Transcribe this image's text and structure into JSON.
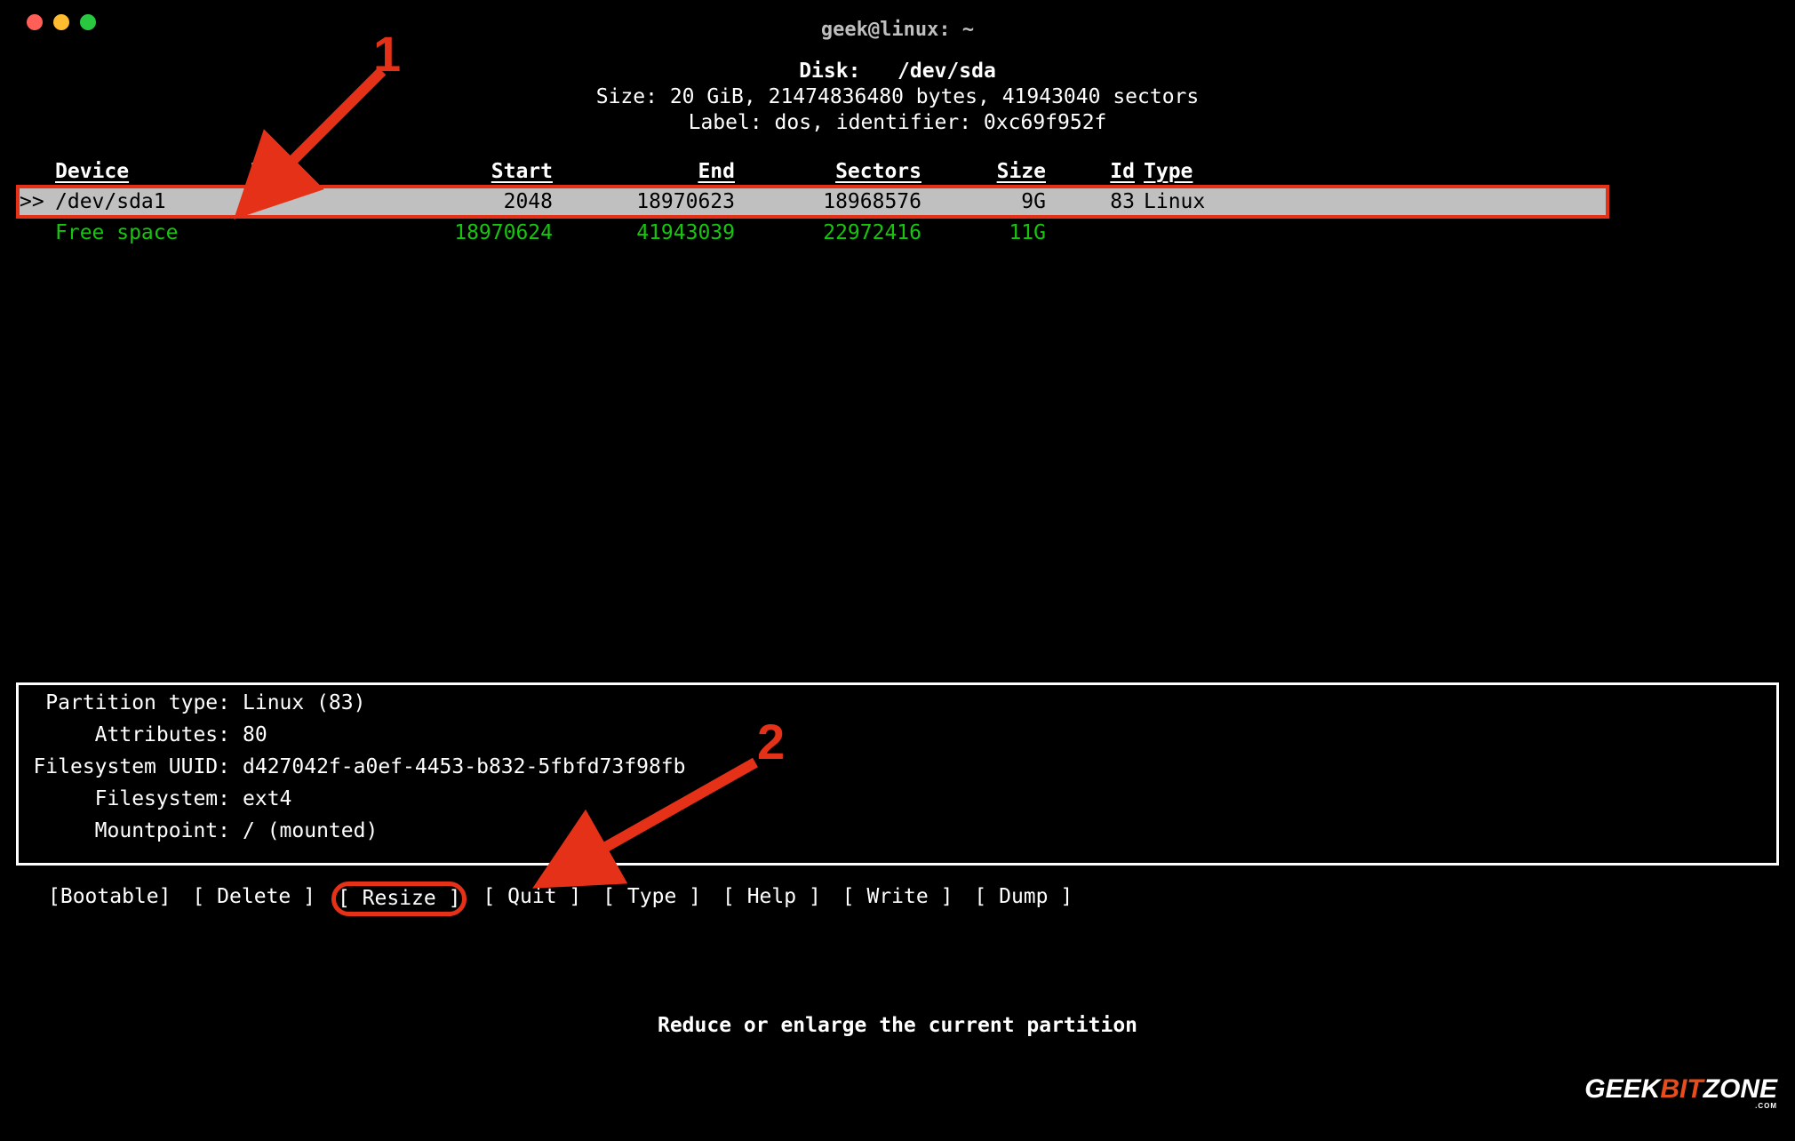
{
  "window": {
    "title": "geek@linux: ~"
  },
  "disk": {
    "label_text": "Disk:",
    "device": "/dev/sda",
    "size_line": "Size: 20 GiB, 21474836480 bytes, 41943040 sectors",
    "label_line": "Label: dos, identifier: 0xc69f952f"
  },
  "columns": {
    "device": "Device",
    "boot": "Boot",
    "start": "Start",
    "end": "End",
    "sectors": "Sectors",
    "size": "Size",
    "id": "Id",
    "type": "Type"
  },
  "rows": [
    {
      "cursor": ">>",
      "device": "/dev/sda1",
      "boot": "*",
      "start": "2048",
      "end": "18970623",
      "sectors": "18968576",
      "size": "9G",
      "id": "83",
      "type": "Linux",
      "selected": true,
      "free": false
    },
    {
      "cursor": "",
      "device": "Free space",
      "boot": "",
      "start": "18970624",
      "end": "41943039",
      "sectors": "22972416",
      "size": "11G",
      "id": "",
      "type": "",
      "selected": false,
      "free": true
    }
  ],
  "details": {
    "partition_type": {
      "key": "Partition type:",
      "value": "Linux (83)"
    },
    "attributes": {
      "key": "Attributes:",
      "value": "80"
    },
    "fs_uuid": {
      "key": "Filesystem UUID:",
      "value": "d427042f-a0ef-4453-b832-5fbfd73f98fb"
    },
    "filesystem": {
      "key": "Filesystem:",
      "value": "ext4"
    },
    "mountpoint": {
      "key": "Mountpoint:",
      "value": "/ (mounted)"
    }
  },
  "menu": {
    "bootable": "[Bootable]",
    "delete": "[ Delete ]",
    "resize": "[ Resize ]",
    "quit": "[  Quit  ]",
    "type": "[  Type  ]",
    "help": "[  Help  ]",
    "write": "[  Write ]",
    "dump": "[  Dump  ]"
  },
  "hint": "Reduce or enlarge the current partition",
  "annotations": {
    "num1": "1",
    "num2": "2"
  },
  "watermark": {
    "part1": "GEEK",
    "part2": "BIT",
    "part3": "ZONE",
    "part4": ".COM"
  }
}
